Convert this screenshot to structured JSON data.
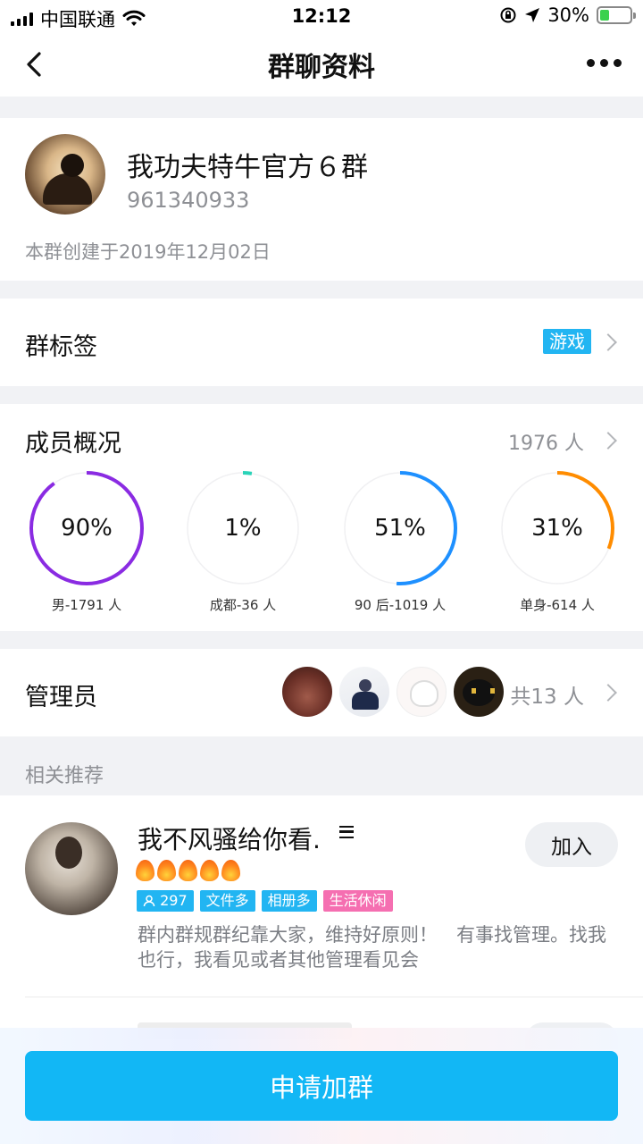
{
  "status_bar": {
    "carrier": "中国联通",
    "time": "12:12",
    "battery": "30%"
  },
  "nav": {
    "title": "群聊资料"
  },
  "group": {
    "name": "我功夫特牛官方６群",
    "id": "961340933",
    "created": "本群创建于2019年12月02日"
  },
  "tags": {
    "label": "群标签",
    "value": "游戏"
  },
  "members": {
    "label": "成员概况",
    "count": "1976 人",
    "stats": [
      {
        "percent": 0.9,
        "text": "90%",
        "caption": "男-1791 人",
        "color": "#8a2be2"
      },
      {
        "percent": 0.01,
        "text": "1%",
        "caption": "成都-36 人",
        "color": "#2ad3b8"
      },
      {
        "percent": 0.51,
        "text": "51%",
        "caption": "90 后-1019 人",
        "color": "#1e90ff"
      },
      {
        "percent": 0.31,
        "text": "31%",
        "caption": "单身-614 人",
        "color": "#ff8c00"
      }
    ]
  },
  "admins": {
    "label": "管理员",
    "total": "共13 人"
  },
  "recommend": {
    "section_title": "相关推荐",
    "item": {
      "name": "我不风骚给你看.",
      "join_label": "加入",
      "badges": [
        "297",
        "文件多",
        "相册多",
        "生活休闲"
      ],
      "description": "群内群规群纪靠大家，维持好原则！　有事找管理。找我也行，我看见或者其他管理看见会"
    }
  },
  "bottom": {
    "apply_label": "申请加群"
  }
}
